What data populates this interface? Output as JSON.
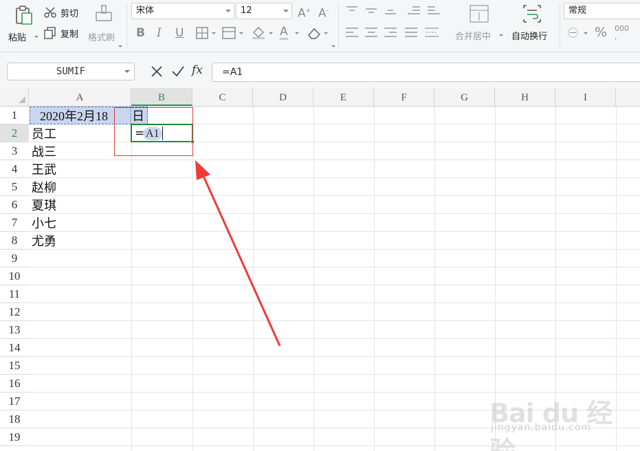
{
  "ribbon": {
    "paste_label": "粘贴",
    "cut_label": "剪切",
    "copy_label": "复制",
    "format_painter_label": "格式刷",
    "font_name": "宋体",
    "font_size": "12",
    "merge_center_label": "合并居中",
    "wrap_text_label": "自动换行",
    "number_format": "常规"
  },
  "formula_bar": {
    "name_box": "SUMIF",
    "fx_label": "fx",
    "formula": "=A1"
  },
  "columns": [
    "A",
    "B",
    "C",
    "D",
    "E",
    "F",
    "G",
    "H",
    "I"
  ],
  "rows": [
    "1",
    "2",
    "3",
    "4",
    "5",
    "6",
    "7",
    "8",
    "9",
    "10",
    "11",
    "12",
    "13",
    "14",
    "15",
    "16",
    "17",
    "18",
    "19"
  ],
  "cells": {
    "A1": "2020年2月18",
    "A1_overflow": "日",
    "A2": "员工",
    "A3": "战三",
    "A4": "王武",
    "A5": "赵柳",
    "A6": "夏琪",
    "A7": "小七",
    "A8": "尤勇",
    "B2_eq": "=",
    "B2_ref": "A1"
  },
  "colors": {
    "selection_green": "#1f8a3c",
    "reference_blue": "#c9d6ee",
    "annotation_red": "#e53935"
  },
  "watermark": {
    "brand": "Bai du 经验",
    "url": "jingyan.baidu.com"
  }
}
